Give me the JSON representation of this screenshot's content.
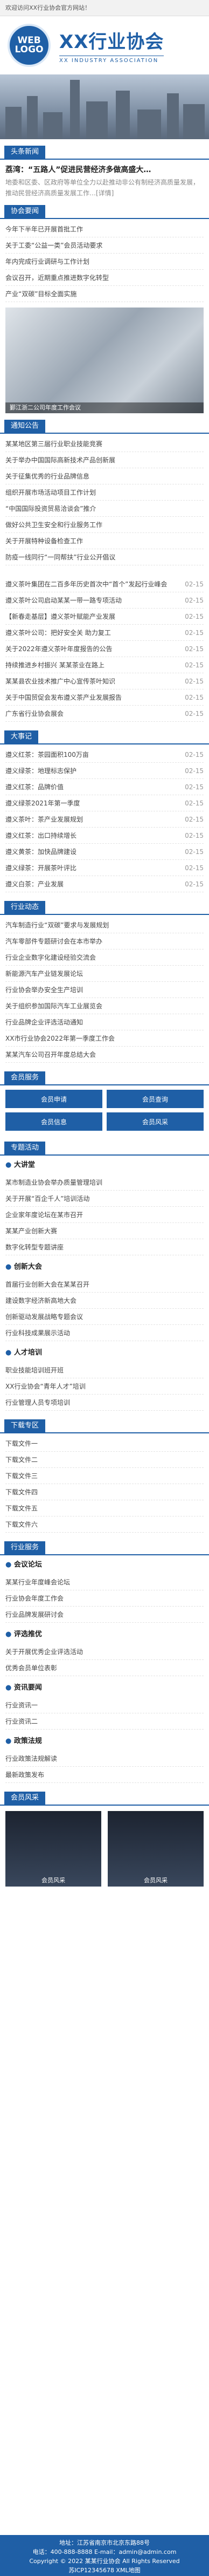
{
  "topbar": "欢迎访问XX行业协会官方网站！",
  "logo": {
    "l1": "WEB",
    "l2": "LOGO"
  },
  "brand": {
    "title": "XX行业协会",
    "sub": "XX INDUSTRY ASSOCIATION"
  },
  "headline": {
    "tab": "头条新闻",
    "title": "荔湾：“五路人”促进民营经济多做高盛大…",
    "desc": "地委和区委、区政府等单位全力以赴推动非公有制经济高质量发展，推动民营经济高质量发展工作…[详情]"
  },
  "notice": {
    "tab": "协会要闻",
    "items": [
      "今年下半年已开展首批工作",
      "关于工委“公益一类”会员活动要求",
      "年内完成行业调研与工作计划",
      "会议召开，近期重点推进数字化转型",
      "产业“双碳”目标全面实施"
    ]
  },
  "photo": {
    "caption": "鄞江浙二公司年度工作会议"
  },
  "trade": {
    "tab": "通知公告",
    "items": [
      "某某地区第三届行业职业技能竞赛",
      "关于举办中国国际高新技术产品创新展",
      "关于征集优秀的行业品牌信息",
      "组织开展市场活动项目工作计划",
      "“中国国际投资贸易洽谈会”推介",
      "做好公共卫生安全和行业服务工作",
      "关于开展特种设备检查工作",
      "防疫一线同行“一同帮扶”行业公开倡议"
    ]
  },
  "news1": {
    "items": [
      [
        "遵义茶叶集团在二百多年历史首次中“首个”发起行业峰会",
        "02-15"
      ],
      [
        "遵义茶叶公司启动某某一带一路专项活动",
        "02-15"
      ],
      [
        "【新春走基层】遵义茶叶赋能产业发展",
        "02-15"
      ],
      [
        "遵义茶叶公司：把好安全关 助力复工",
        "02-15"
      ],
      [
        "关于2022年遵义茶叶年度报告的公告",
        "02-15"
      ],
      [
        "持续推进乡村振兴 某某茶业在路上",
        "02-15"
      ],
      [
        "某某县农业技术推广中心宣传茶叶知识",
        "02-15"
      ],
      [
        "关于中国贸促会发布遵义茶产业发展报告",
        "02-15"
      ],
      [
        "广东省行业协会展会",
        "02-15"
      ]
    ]
  },
  "news2": {
    "tab": "大事记",
    "items": [
      [
        "遵义红茶：茶园面积100万亩",
        "02-15"
      ],
      [
        "遵义绿茶：地理标志保护",
        "02-15"
      ],
      [
        "遵义红茶：品牌价值",
        "02-15"
      ],
      [
        "遵义绿茶2021年第一季度",
        "02-15"
      ],
      [
        "遵义茶叶：茶产业发展规划",
        "02-15"
      ],
      [
        "遵义红茶：出口持续增长",
        "02-15"
      ],
      [
        "遵义黄茶：加快品牌建设",
        "02-15"
      ],
      [
        "遵义绿茶：开展茶叶评比",
        "02-15"
      ],
      [
        "遵义白茶：产业发展",
        "02-15"
      ]
    ]
  },
  "news3": {
    "tab": "行业动态",
    "items": [
      "汽车制造行业“双碳”要求与发展规划",
      "汽车零部件专题研讨会在本市举办",
      "行业企业数字化建设经验交流会",
      "新能源汽车产业链发展论坛",
      "行业协会举办安全生产培训",
      "关于组织参加国际汽车工业展览会",
      "行业品牌企业评选活动通知",
      "XX市行业协会2022年第一季度工作会",
      "某某汽车公司召开年度总结大会"
    ]
  },
  "services": {
    "tab": "会员服务",
    "items": [
      "会员申请",
      "会员查询",
      "会员信息",
      "会员风采"
    ]
  },
  "special": {
    "tab": "专题活动",
    "sub1": "大讲堂",
    "items1": [
      "某市制造业协会举办质量管理培训",
      "关于开展“百企千人”培训活动",
      "企业家年度论坛在某市召开",
      "某某产业创新大赛",
      "数字化转型专题讲座"
    ],
    "sub2": "创新大会",
    "items2": [
      "首届行业创新大会在某某召开",
      "建设数字经济新高地大会",
      "创新驱动发展战略专题会议",
      "行业科技成果展示活动"
    ],
    "sub3": "人才培训",
    "items3": [
      "职业技能培训班开班",
      "XX行业协会“青年人才”培训",
      "行业管理人员专项培训"
    ]
  },
  "download": {
    "tab": "下载专区",
    "items": [
      "下载文件一",
      "下载文件二",
      "下载文件三",
      "下载文件四",
      "下载文件五",
      "下载文件六"
    ]
  },
  "industry": {
    "tab": "行业服务",
    "sub1": "会议论坛",
    "items1": [
      "某某行业年度峰会论坛",
      "行业协会年度工作会",
      "行业品牌发展研讨会"
    ],
    "sub2": "评选推优",
    "items2": [
      "关于开展优秀企业评选活动",
      "优秀会员单位表彰"
    ],
    "sub3": "资讯要闻",
    "items3": [
      "行业资讯一",
      "行业资讯二"
    ],
    "sub4": "政策法规",
    "items4": [
      "行业政策法规解读",
      "最新政策发布"
    ]
  },
  "gallery": {
    "tab": "会员风采",
    "items": [
      "会员风采",
      "会员风采"
    ]
  },
  "footer": {
    "l1": "地址：江苏省南京市北京东路88号",
    "l2": "电话：400-888-8888  E-mail：admin@admin.com",
    "l3": "Copyright © 2022 某某行业协会 All Rights Reserved",
    "l4": "苏ICP12345678  XML地图"
  }
}
